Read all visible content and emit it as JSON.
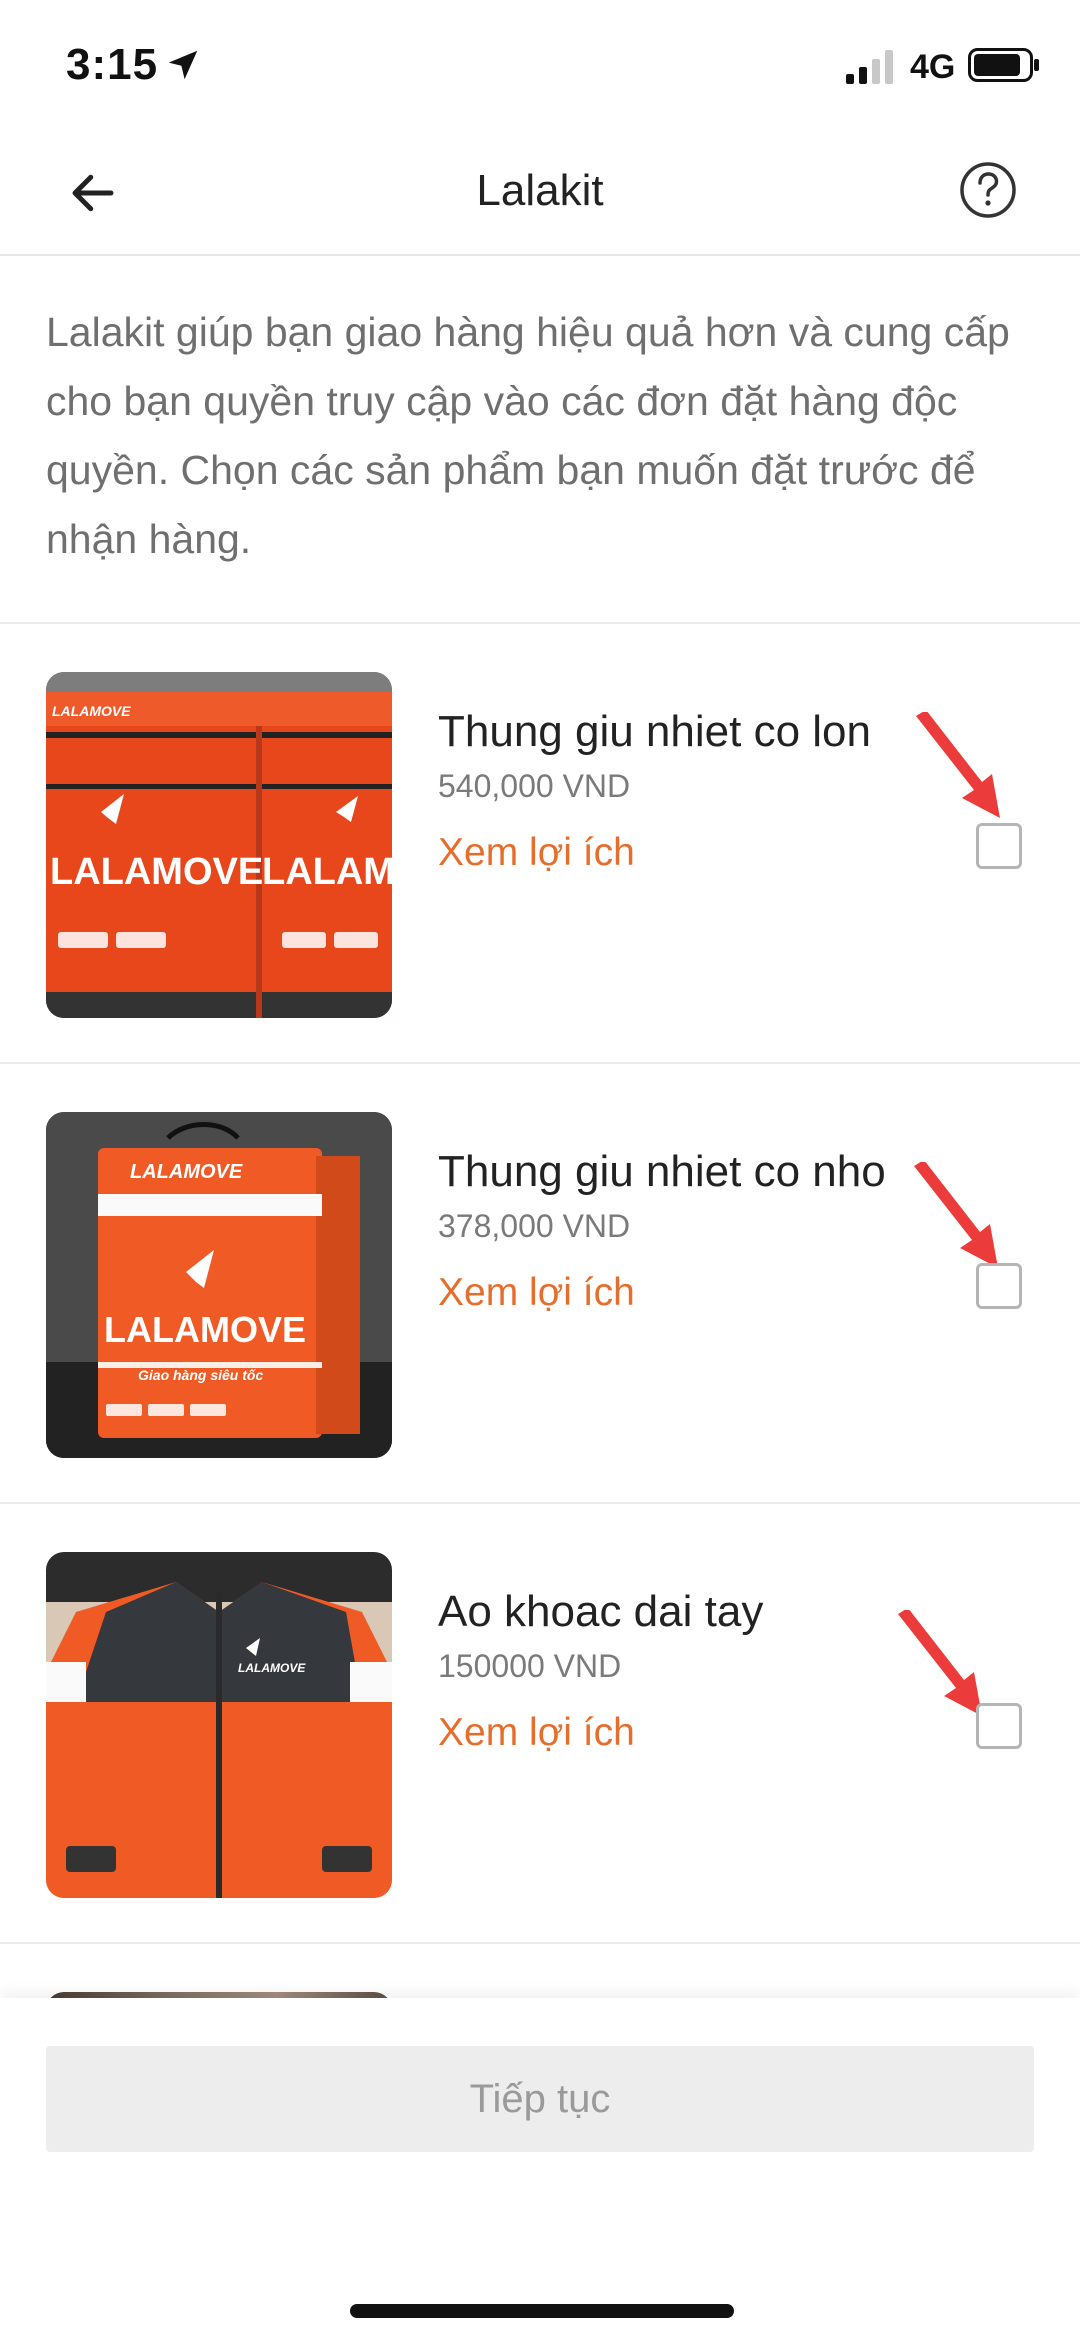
{
  "status_bar": {
    "time": "3:15",
    "network": "4G"
  },
  "header": {
    "title": "Lalakit"
  },
  "description": "Lalakit giúp bạn giao hàng hiệu quả hơn và cung cấp cho bạn quyền truy cập vào các đơn đặt hàng độc quyền. Chọn các sản phẩm bạn muốn đặt trước để nhận hàng.",
  "products": [
    {
      "name": "Thung giu nhiet co lon",
      "price": "540,000 VND",
      "benefit_link": "Xem lợi ích",
      "checked": false,
      "image_brand": "LALAMOVE"
    },
    {
      "name": "Thung giu nhiet co nho",
      "price": "378,000 VND",
      "benefit_link": "Xem lợi ích",
      "checked": false,
      "image_brand": "LALAMOVE",
      "image_tagline": "Giao hàng siêu tốc"
    },
    {
      "name": "Ao khoac dai tay",
      "price": "150000 VND",
      "benefit_link": "Xem lợi ích",
      "checked": false,
      "image_brand": "LALAMOVE"
    }
  ],
  "footer": {
    "continue_label": "Tiếp tục"
  },
  "colors": {
    "accent": "#e66e2d",
    "annotation_arrow": "#ec3b3b",
    "disabled_button": "#ededed"
  },
  "icons": [
    "location-arrow-icon",
    "signal-icon",
    "battery-icon",
    "back-arrow-icon",
    "help-icon"
  ]
}
